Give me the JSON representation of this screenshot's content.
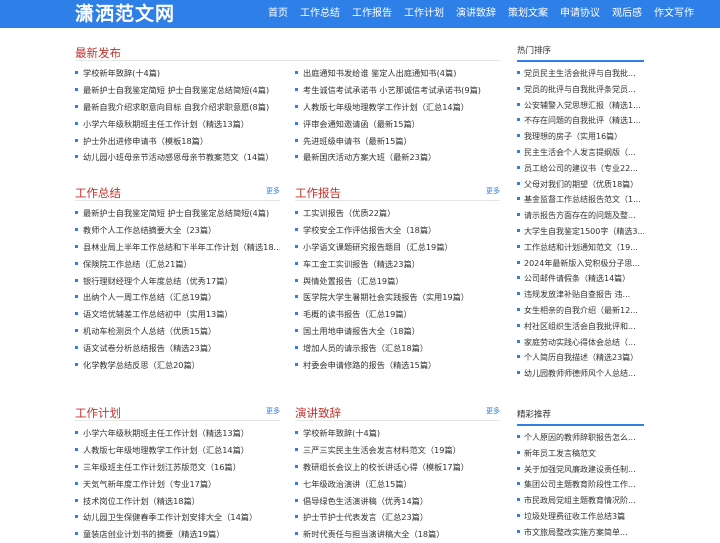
{
  "brand": {
    "logo": "潇洒范文网"
  },
  "nav": [
    "首页",
    "工作总结",
    "工作报告",
    "工作计划",
    "演讲致辞",
    "策划文案",
    "申请协议",
    "观后感",
    "作文写作"
  ],
  "latest": {
    "title": "最新发布",
    "left": [
      "学校新年致辞(十4篇)",
      "最新护士自我鉴定简短 护士自我鉴定总结简短(4篇)",
      "最新自我介绍求职意向目标 自我介绍求职意愿(8篇)",
      "小学六年级秋期班主任工作计划（精选13篇）",
      "护士外出进修申请书（模板18篇）",
      "幼儿园小班母亲节活动感恩母亲节教案范文（14篇）"
    ],
    "right": [
      "出庭通知书发给谁 鉴定人出庭通知书(4篇)",
      "考生诚信考试承诺书 小艺那诚信考试承诺书(9篇)",
      "人教版七年级地理教学工作计划（汇总14篇）",
      "评审会通知邀请函（最新15篇）",
      "先进班级申请书（最新15篇）",
      "最新国庆活动方案大班（最新23篇）"
    ]
  },
  "sections": [
    {
      "title": "工作总结",
      "more": "更多",
      "items": [
        "最新护士自我鉴定简短 护士自我鉴定总结简短(4篇)",
        "教师个人工作总结摘要大全（23篇）",
        "县林业局上半年工作总结和下半年工作计划（精选18...",
        "保険院工作总结（汇总21篇）",
        "银行理财经理个人年度总结（优秀17篇）",
        "出纳个人一周工作总结（汇总19篇）",
        "语文培优辅差工作总结初中（实用13篇）",
        "机动车检测员个人总结（优质15篇）",
        "语文试卷分析总结报告（精选23篇）",
        "化学教学总结反思（汇总20篇）"
      ]
    },
    {
      "title": "工作报告",
      "more": "更多",
      "items": [
        "工实训报告（优质22篇）",
        "学校安全工作评估报告大全（18篇）",
        "小学语文课题研究报告题目（汇总19篇）",
        "车工金工实训报告（精选23篇）",
        "舆情处置报告（汇总19篇）",
        "医学院大学生暑期社会实践报告（实用19篇）",
        "毛概的读书报告（汇总19篇）",
        "国土用地申请报告大全（18篇）",
        "增加人员的请示报告（汇总18篇）",
        "村委会申请修路的报告（精选15篇）"
      ]
    },
    {
      "title": "工作计划",
      "more": "更多",
      "items": [
        "小学六年级秋期班主任工作计划（精选13篇）",
        "人教版七年级地理教学工作计划（汇总14篇）",
        "三年级班主任工作计划江苏版范文（16篇）",
        "天気气新年度工作计划（专业17篇）",
        "技术岗位工作计划（精选18篇）",
        "幼儿园卫生保健春季工作计划安排大全（14篇）",
        "童装店创业计划书的摘要（精选19篇）"
      ]
    },
    {
      "title": "演讲致辞",
      "more": "更多",
      "items": [
        "学校新年致辞(十4篇)",
        "三严三实民主生活会发言材料范文（19篇）",
        "教研组长会议上的校长讲话心得（模板17篇）",
        "七年级政治演讲（汇总15篇）",
        "倡导绿色生活演讲稿（优秀14篇）",
        "护士节护士代表发言（汇总23篇）",
        "新时代责任与担当演讲稿大全（18篇）"
      ]
    }
  ],
  "sidebar": {
    "hot": {
      "title": "热门排序",
      "items": [
        "党员民主生活会批评与自我批...",
        "党员的批评与自我批评条党员...",
        "公安辅警入党思想汇报（精选1...",
        "不存在问题的自我批评（精选1...",
        "我理想的房子（实用16篇）",
        "民主生活会个人发言提纲版（...",
        "员工给公司的建议书（专业22...",
        "父母对我们的期望（优质18篇）",
        "基金监督工作总结报告范文（1...",
        "请示报告方面存在的问题及整...",
        "大学生自我鉴定1500字（精选3...",
        "工作总结和计划通知范文（19...",
        "2024年最新版入党积极分子思...",
        "公司邮件请假条（精选14篇）",
        "违规发放津补贴自查报告 违...",
        "女生相亲的自我介绍（最新12...",
        "村社区组织生活会自我批评和...",
        "家庭劳动实践心得体会总结（...",
        "个人简历自我描述（精选23篇）",
        "幼儿园教师师德师风个人总结..."
      ]
    },
    "rec": {
      "title": "精彩推荐",
      "items": [
        "个人原因的教师辞职报告怎么...",
        "新年员工发言稿范文",
        "关于加强党风廉政建设责任制...",
        "集团公司主题教育阶段性工作...",
        "市民政局党组主题教育情况阶...",
        "垃圾处理费征收工作总结3篇",
        "市文旅局整改实施方案简单..."
      ]
    }
  }
}
